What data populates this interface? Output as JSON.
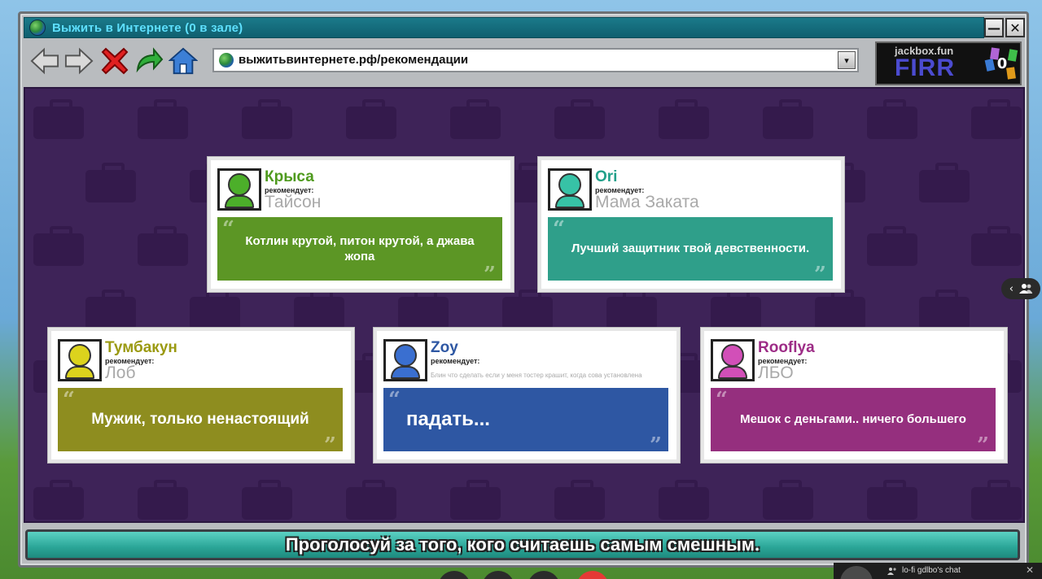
{
  "window": {
    "title": "Выжить в Интернете  (0 в зале)",
    "minimize_label": "—",
    "close_label": "✕"
  },
  "toolbar": {
    "back_icon": "back-arrow-icon",
    "forward_icon": "forward-arrow-icon",
    "stop_icon": "red-x-icon",
    "refresh_icon": "refresh-arrow-icon",
    "home_icon": "home-icon",
    "address": "выжитьвинтернете.рф/рекомендации",
    "dropdown_glyph": "▾"
  },
  "room": {
    "url": "jackbox.fun",
    "code": "FIRR",
    "audience_count": "0"
  },
  "cards": [
    {
      "player": "Крыса",
      "recommends_label": "рекомендует:",
      "target": "Тайсон",
      "quote": "Котлин крутой, питон крутой, а джава жопа",
      "color": "#5c9625",
      "name_color": "#4f9a1e",
      "avatar_color": "#4caf2a"
    },
    {
      "player": "Ori",
      "recommends_label": "рекомендует:",
      "target": "Мама Заката",
      "quote": "Лучший защитник твой девственности.",
      "color": "#2f9f8a",
      "name_color": "#22a08a",
      "avatar_color": "#37c2a6"
    },
    {
      "player": "Тумбакун",
      "recommends_label": "рекомендует:",
      "target": "Лоб",
      "quote": "Мужик, только ненастоящий",
      "color": "#8e8d1f",
      "name_color": "#9b9a12",
      "avatar_color": "#dcd31d"
    },
    {
      "player": "Zoy",
      "recommends_label": "рекомендует:",
      "target": "Блин что сделать если у меня тостер крашит, когда сова установлена",
      "quote": "падать...",
      "color": "#2e57a3",
      "name_color": "#2e57a3",
      "avatar_color": "#3a6fd0"
    },
    {
      "player": "Rooflya",
      "recommends_label": "рекомендует:",
      "target": "ЛБО",
      "quote": "Мешок с деньгами.. ничего большего",
      "color": "#952f7e",
      "name_color": "#9d2c86",
      "avatar_color": "#d24fb8"
    }
  ],
  "prompt": "Проголосуй за того, кого считаешь самым смешным.",
  "stream": {
    "chat_title": "lo-fi gdlbo's chat",
    "side_arrow": "‹",
    "people_icon": "people-icon",
    "chat_close": "✕"
  }
}
